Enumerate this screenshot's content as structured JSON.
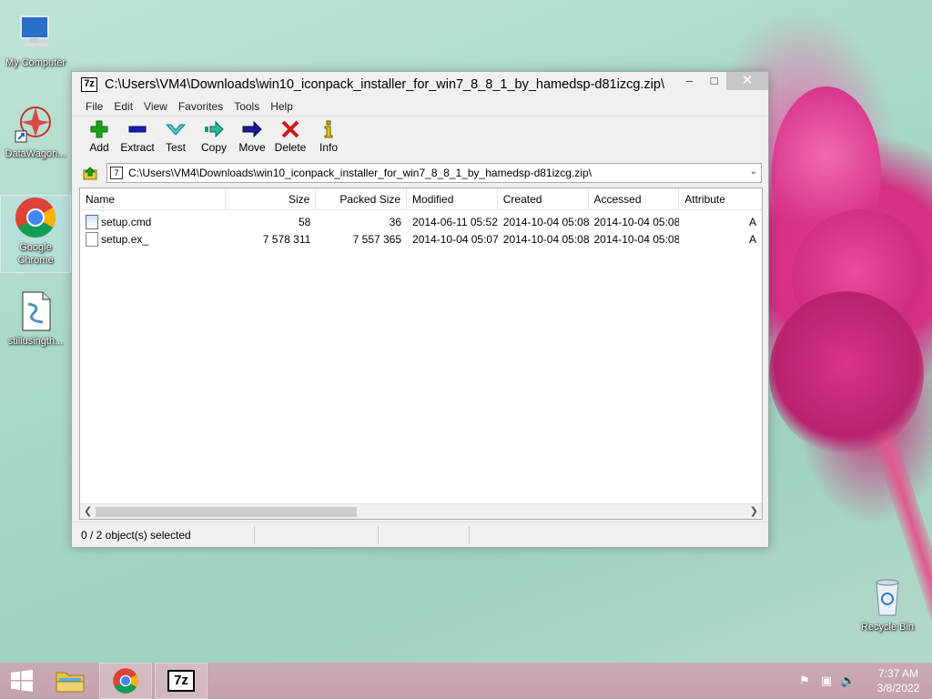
{
  "desktop": {
    "icons": [
      {
        "label": "My Computer"
      },
      {
        "label": "DataWagon..."
      },
      {
        "label": "Google Chrome"
      },
      {
        "label": "stillusingth..."
      },
      {
        "label": "Recycle Bin"
      }
    ]
  },
  "window": {
    "title": "C:\\Users\\VM4\\Downloads\\win10_iconpack_installer_for_win7_8_8_1_by_hamedsp-d81izcg.zip\\",
    "app_icon_label": "7z",
    "controls": {
      "minimize": "–",
      "maximize": "□",
      "close": "✕"
    }
  },
  "menu": [
    "File",
    "Edit",
    "View",
    "Favorites",
    "Tools",
    "Help"
  ],
  "toolbar": [
    {
      "label": "Add",
      "icon": "add-icon",
      "color": "#1aa21a"
    },
    {
      "label": "Extract",
      "icon": "extract-icon",
      "color": "#1b1bb0"
    },
    {
      "label": "Test",
      "icon": "test-icon",
      "color": "#1a9aa8"
    },
    {
      "label": "Copy",
      "icon": "copy-icon",
      "color": "#1a9a7a"
    },
    {
      "label": "Move",
      "icon": "move-icon",
      "color": "#1a1a90"
    },
    {
      "label": "Delete",
      "icon": "delete-icon",
      "color": "#d01a1a"
    },
    {
      "label": "Info",
      "icon": "info-icon",
      "color": "#c9a800"
    }
  ],
  "address": {
    "path": "C:\\Users\\VM4\\Downloads\\win10_iconpack_installer_for_win7_8_8_1_by_hamedsp-d81izcg.zip\\"
  },
  "columns": [
    "Name",
    "Size",
    "Packed Size",
    "Modified",
    "Created",
    "Accessed",
    "Attribute"
  ],
  "files": [
    {
      "name": "setup.cmd",
      "size": "58",
      "packed": "36",
      "modified": "2014-06-11 05:52",
      "created": "2014-10-04 05:08",
      "accessed": "2014-10-04 05:08",
      "attr": "A"
    },
    {
      "name": "setup.ex_",
      "size": "7 578 311",
      "packed": "7 557 365",
      "modified": "2014-10-04 05:07",
      "created": "2014-10-04 05:08",
      "accessed": "2014-10-04 05:08",
      "attr": "A"
    }
  ],
  "status": {
    "selection": "0 / 2 object(s) selected"
  },
  "taskbar": {
    "time": "7:37 AM",
    "date": "3/8/2022"
  }
}
